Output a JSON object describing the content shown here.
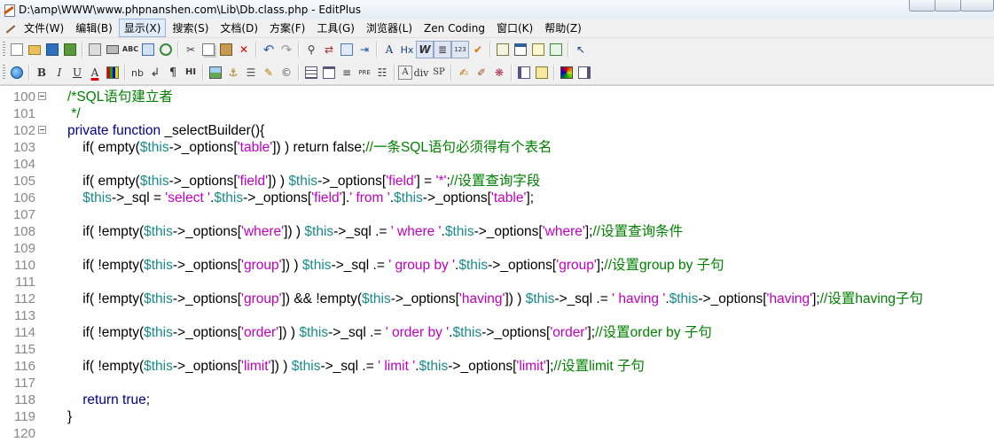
{
  "window": {
    "title": "D:\\amp\\WWW\\www.phpnanshen.com\\Lib\\Db.class.php - EditPlus"
  },
  "menu": {
    "items": [
      "文件(W)",
      "编辑(B)",
      "显示(X)",
      "搜索(S)",
      "文档(D)",
      "方案(F)",
      "工具(G)",
      "浏览器(L)",
      "Zen Coding",
      "窗口(K)",
      "帮助(Z)"
    ],
    "active": "显示(X)"
  },
  "toolbar2_text": {
    "bold": "B",
    "italic": "I",
    "underline": "U",
    "font": "A",
    "nb": "nb",
    "para": "¶",
    "hi": "HI",
    "pre": "PRE",
    "div": "div",
    "sp": "SP",
    "abc": "ABC",
    "hx": "Hx"
  },
  "editor": {
    "lines": [
      {
        "num": "100",
        "fold": true,
        "parts": [
          [
            "c-com",
            "/*SQL语句建立者"
          ]
        ]
      },
      {
        "num": "101",
        "fold": false,
        "parts": [
          [
            "c-com",
            " */"
          ]
        ]
      },
      {
        "num": "102",
        "fold": true,
        "parts": [
          [
            "c-kw",
            "private function "
          ],
          [
            "c-op",
            "_selectBuilder(){"
          ]
        ]
      },
      {
        "num": "103",
        "fold": false,
        "parts": [
          [
            "c-op",
            "    if( empty("
          ],
          [
            "c-var",
            "$this"
          ],
          [
            "c-op",
            "->_options["
          ],
          [
            "c-str",
            "'table'"
          ],
          [
            "c-op",
            "]) ) return false;"
          ],
          [
            "c-com",
            "//一条SQL语句必须得有个表名"
          ]
        ]
      },
      {
        "num": "104",
        "fold": false,
        "parts": []
      },
      {
        "num": "105",
        "fold": false,
        "parts": [
          [
            "c-op",
            "    if( empty("
          ],
          [
            "c-var",
            "$this"
          ],
          [
            "c-op",
            "->_options["
          ],
          [
            "c-str",
            "'field'"
          ],
          [
            "c-op",
            "]) ) "
          ],
          [
            "c-var",
            "$this"
          ],
          [
            "c-op",
            "->_options["
          ],
          [
            "c-str",
            "'field'"
          ],
          [
            "c-op",
            "] = "
          ],
          [
            "c-str",
            "'*'"
          ],
          [
            "c-op",
            ";"
          ],
          [
            "c-com",
            "//设置查询字段"
          ]
        ]
      },
      {
        "num": "106",
        "fold": false,
        "parts": [
          [
            "c-op",
            "    "
          ],
          [
            "c-var",
            "$this"
          ],
          [
            "c-op",
            "->_sql = "
          ],
          [
            "c-str",
            "'select '"
          ],
          [
            "c-op",
            "."
          ],
          [
            "c-var",
            "$this"
          ],
          [
            "c-op",
            "->_options["
          ],
          [
            "c-str",
            "'field'"
          ],
          [
            "c-op",
            "]."
          ],
          [
            "c-str",
            "' from '"
          ],
          [
            "c-op",
            "."
          ],
          [
            "c-var",
            "$this"
          ],
          [
            "c-op",
            "->_options["
          ],
          [
            "c-str",
            "'table'"
          ],
          [
            "c-op",
            "];"
          ]
        ]
      },
      {
        "num": "107",
        "fold": false,
        "parts": []
      },
      {
        "num": "108",
        "fold": false,
        "parts": [
          [
            "c-op",
            "    if( !empty("
          ],
          [
            "c-var",
            "$this"
          ],
          [
            "c-op",
            "->_options["
          ],
          [
            "c-str",
            "'where'"
          ],
          [
            "c-op",
            "]) ) "
          ],
          [
            "c-var",
            "$this"
          ],
          [
            "c-op",
            "->_sql .= "
          ],
          [
            "c-str",
            "' where '"
          ],
          [
            "c-op",
            "."
          ],
          [
            "c-var",
            "$this"
          ],
          [
            "c-op",
            "->_options["
          ],
          [
            "c-str",
            "'where'"
          ],
          [
            "c-op",
            "];"
          ],
          [
            "c-com",
            "//设置查询条件"
          ]
        ]
      },
      {
        "num": "109",
        "fold": false,
        "parts": []
      },
      {
        "num": "110",
        "fold": false,
        "parts": [
          [
            "c-op",
            "    if( !empty("
          ],
          [
            "c-var",
            "$this"
          ],
          [
            "c-op",
            "->_options["
          ],
          [
            "c-str",
            "'group'"
          ],
          [
            "c-op",
            "]) ) "
          ],
          [
            "c-var",
            "$this"
          ],
          [
            "c-op",
            "->_sql .= "
          ],
          [
            "c-str",
            "' group by '"
          ],
          [
            "c-op",
            "."
          ],
          [
            "c-var",
            "$this"
          ],
          [
            "c-op",
            "->_options["
          ],
          [
            "c-str",
            "'group'"
          ],
          [
            "c-op",
            "];"
          ],
          [
            "c-com",
            "//设置group by 子句"
          ]
        ]
      },
      {
        "num": "111",
        "fold": false,
        "parts": []
      },
      {
        "num": "112",
        "fold": false,
        "parts": [
          [
            "c-op",
            "    if( !empty("
          ],
          [
            "c-var",
            "$this"
          ],
          [
            "c-op",
            "->_options["
          ],
          [
            "c-str",
            "'group'"
          ],
          [
            "c-op",
            "]) && !empty("
          ],
          [
            "c-var",
            "$this"
          ],
          [
            "c-op",
            "->_options["
          ],
          [
            "c-str",
            "'having'"
          ],
          [
            "c-op",
            "]) ) "
          ],
          [
            "c-var",
            "$this"
          ],
          [
            "c-op",
            "->_sql .= "
          ],
          [
            "c-str",
            "' having '"
          ],
          [
            "c-op",
            "."
          ],
          [
            "c-var",
            "$this"
          ],
          [
            "c-op",
            "->_options["
          ],
          [
            "c-str",
            "'having'"
          ],
          [
            "c-op",
            "];"
          ],
          [
            "c-com",
            "//设置having子句"
          ]
        ]
      },
      {
        "num": "113",
        "fold": false,
        "parts": []
      },
      {
        "num": "114",
        "fold": false,
        "parts": [
          [
            "c-op",
            "    if( !empty("
          ],
          [
            "c-var",
            "$this"
          ],
          [
            "c-op",
            "->_options["
          ],
          [
            "c-str",
            "'order'"
          ],
          [
            "c-op",
            "]) ) "
          ],
          [
            "c-var",
            "$this"
          ],
          [
            "c-op",
            "->_sql .= "
          ],
          [
            "c-str",
            "' order by '"
          ],
          [
            "c-op",
            "."
          ],
          [
            "c-var",
            "$this"
          ],
          [
            "c-op",
            "->_options["
          ],
          [
            "c-str",
            "'order'"
          ],
          [
            "c-op",
            "];"
          ],
          [
            "c-com",
            "//设置order by 子句"
          ]
        ]
      },
      {
        "num": "115",
        "fold": false,
        "parts": []
      },
      {
        "num": "116",
        "fold": false,
        "parts": [
          [
            "c-op",
            "    if( !empty("
          ],
          [
            "c-var",
            "$this"
          ],
          [
            "c-op",
            "->_options["
          ],
          [
            "c-str",
            "'limit'"
          ],
          [
            "c-op",
            "]) ) "
          ],
          [
            "c-var",
            "$this"
          ],
          [
            "c-op",
            "->_sql .= "
          ],
          [
            "c-str",
            "' limit '"
          ],
          [
            "c-op",
            "."
          ],
          [
            "c-var",
            "$this"
          ],
          [
            "c-op",
            "->_options["
          ],
          [
            "c-str",
            "'limit'"
          ],
          [
            "c-op",
            "];"
          ],
          [
            "c-com",
            "//设置limit 子句"
          ]
        ]
      },
      {
        "num": "117",
        "fold": false,
        "parts": []
      },
      {
        "num": "118",
        "fold": false,
        "parts": [
          [
            "c-op",
            "    "
          ],
          [
            "c-kw",
            "return true"
          ],
          [
            "c-op",
            ";"
          ]
        ]
      },
      {
        "num": "119",
        "fold": false,
        "parts": [
          [
            "c-op",
            "}"
          ]
        ]
      },
      {
        "num": "120",
        "fold": false,
        "parts": []
      }
    ]
  }
}
